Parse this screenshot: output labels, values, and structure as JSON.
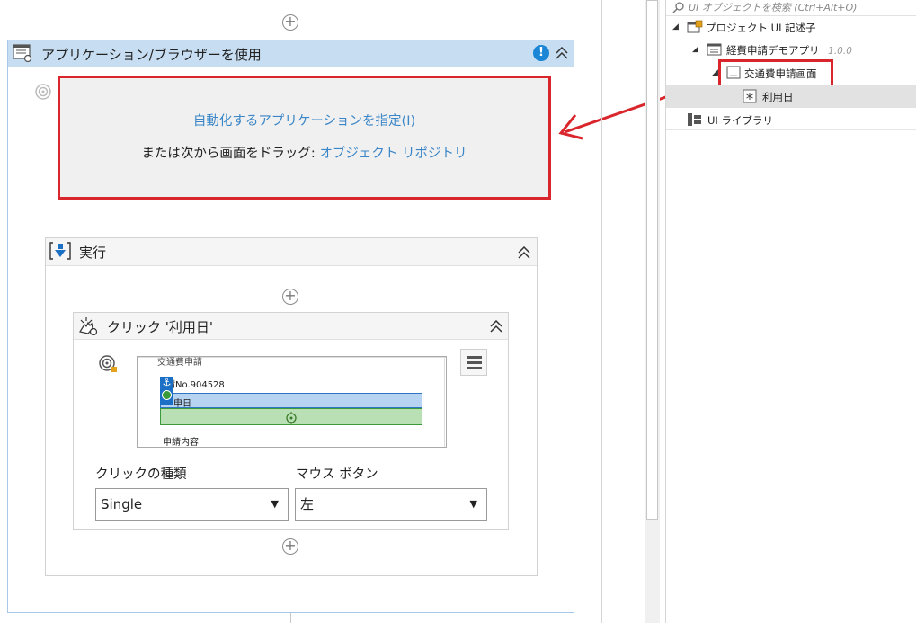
{
  "designer": {
    "use_app": {
      "title": "アプリケーション/ブラウザーを使用",
      "indicate_link": "自動化するアプリケーションを指定(I)",
      "drag_prefix": "または次から画面をドラッグ: ",
      "drag_link": "オブジェクト リポジトリ"
    },
    "do": {
      "title": "実行"
    },
    "click": {
      "title": "クリック '利用日'",
      "preview": {
        "line1": "交通費申請",
        "line2": "請No.904528",
        "line3": "申日",
        "line4": "申請内容"
      },
      "click_type_label": "クリックの種類",
      "click_type_value": "Single",
      "mouse_button_label": "マウス ボタン",
      "mouse_button_value": "左"
    }
  },
  "object_repository": {
    "search_placeholder": "UI オブジェクトを検索 (Ctrl+Alt+O)",
    "tree": {
      "project": "プロジェクト UI 記述子",
      "app": "経費申請デモアプリ",
      "app_version": "1.0.0",
      "screen": "交通費申請画面",
      "element": "利用日",
      "library": "UI ライブラリ"
    }
  },
  "colors": {
    "highlight_red": "#d9262c",
    "link_blue": "#3a86c8",
    "header_blue": "#c7def2"
  }
}
